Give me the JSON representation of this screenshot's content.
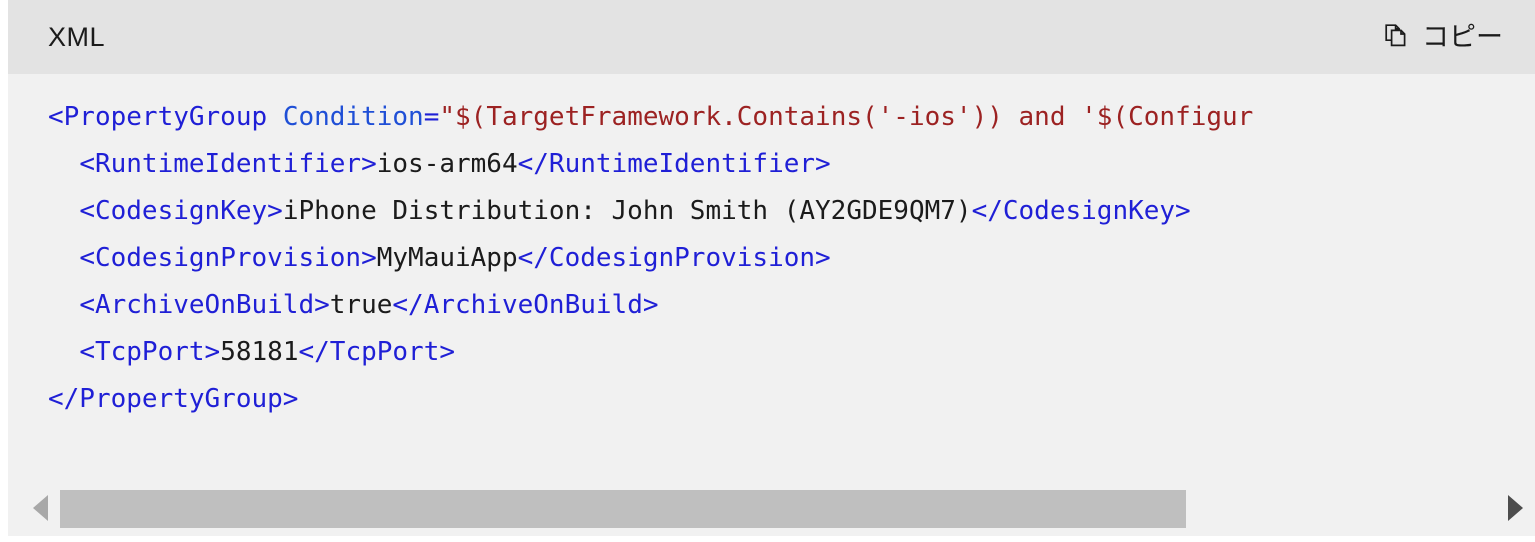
{
  "header": {
    "language_label": "XML",
    "copy_button_label": "コピー",
    "copy_icon": "copy-icon",
    "background_color": "#e3e3e3",
    "text_color": "#1b1b1b"
  },
  "code": {
    "language": "XML",
    "background_color": "#f1f1f1",
    "colors": {
      "tag": "#1f1fd6",
      "attribute": "#1f4fd6",
      "string": "#9c2222",
      "text": "#1b1b1b"
    },
    "full_text": "<PropertyGroup Condition=\"$(TargetFramework.Contains('-ios')) and '$(Configur\n  <RuntimeIdentifier>ios-arm64</RuntimeIdentifier>\n  <CodesignKey>iPhone Distribution: John Smith (AY2GDE9QM7)</CodesignKey>\n  <CodesignProvision>MyMauiApp</CodesignProvision>\n  <ArchiveOnBuild>true</ArchiveOnBuild>\n  <TcpPort>58181</TcpPort>\n</PropertyGroup>",
    "lines": [
      {
        "indent": "",
        "tokens": [
          {
            "type": "tag",
            "text": "<PropertyGroup "
          },
          {
            "type": "attribute",
            "text": "Condition"
          },
          {
            "type": "tag",
            "text": "="
          },
          {
            "type": "string",
            "text": "\"$(TargetFramework.Contains('-ios')) and '$(Configur"
          }
        ]
      },
      {
        "indent": "  ",
        "tokens": [
          {
            "type": "tag",
            "text": "<RuntimeIdentifier>"
          },
          {
            "type": "text",
            "text": "ios-arm64"
          },
          {
            "type": "tag",
            "text": "</RuntimeIdentifier>"
          }
        ]
      },
      {
        "indent": "  ",
        "tokens": [
          {
            "type": "tag",
            "text": "<CodesignKey>"
          },
          {
            "type": "text",
            "text": "iPhone Distribution: John Smith (AY2GDE9QM7)"
          },
          {
            "type": "tag",
            "text": "</CodesignKey>"
          }
        ]
      },
      {
        "indent": "  ",
        "tokens": [
          {
            "type": "tag",
            "text": "<CodesignProvision>"
          },
          {
            "type": "text",
            "text": "MyMauiApp"
          },
          {
            "type": "tag",
            "text": "</CodesignProvision>"
          }
        ]
      },
      {
        "indent": "  ",
        "tokens": [
          {
            "type": "tag",
            "text": "<ArchiveOnBuild>"
          },
          {
            "type": "text",
            "text": "true"
          },
          {
            "type": "tag",
            "text": "</ArchiveOnBuild>"
          }
        ]
      },
      {
        "indent": "  ",
        "tokens": [
          {
            "type": "tag",
            "text": "<TcpPort>"
          },
          {
            "type": "text",
            "text": "58181"
          },
          {
            "type": "tag",
            "text": "</TcpPort>"
          }
        ]
      },
      {
        "indent": "",
        "tokens": [
          {
            "type": "tag",
            "text": "</PropertyGroup>"
          }
        ]
      }
    ]
  },
  "scrollbar": {
    "orientation": "horizontal",
    "left_arrow_icon": "chevron-left-icon",
    "right_arrow_icon": "chevron-right-icon",
    "thumb_color": "#bfbfbf",
    "track_color": "#f1f1f1",
    "left_arrow_color": "#a8a8a8",
    "right_arrow_color": "#4d4d4d"
  }
}
